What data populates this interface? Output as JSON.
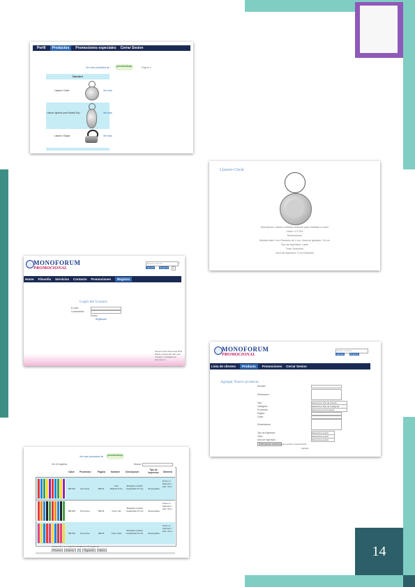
{
  "page": {
    "number": "14"
  },
  "colors": {
    "teal_light": "#7fcdc3",
    "teal_dark": "#3d8f86",
    "navy": "#2c5f67",
    "purple": "#8e59b8"
  },
  "shot1": {
    "nav": [
      "Perfil",
      "Productos",
      "Promociones especiales",
      "Cerrar Sesion"
    ],
    "header_text": "Ver mas productos de",
    "logo_text": "promoshop",
    "page_text": "Pagina 1",
    "column_header": "Nombre",
    "rows": [
      {
        "name": "Llavero Circle",
        "link": "Ver mas"
      },
      {
        "name": "Llavero Ignition para Botella Esp",
        "link": "Ver mas"
      },
      {
        "name": "Llavero Shape",
        "link": "Ver mas"
      }
    ]
  },
  "shot2": {
    "title": "Llavero Circle",
    "lines": [
      "Descripcion: Llavero metalico redondo para Grabado a Laser",
      "Clave: LLT-001",
      "Dimensiones:",
      "Medida total: 9 cm Diametro de 4 cm / Area de grabado: 2.8 cm",
      "Tipo de impresion: Laser",
      "Tinta: Seleccion",
      "Area de impresion: 2 cm Diametro"
    ]
  },
  "shot3": {
    "logo": "MONOFORUM",
    "logo_sub": "PROMOCIONAL",
    "search_placeholder": "Buscar producto",
    "login_button": "Ingresar",
    "register_button": "Registrar",
    "nav": [
      "Home",
      "Filosofia",
      "Servicios",
      "Contacto",
      "Promociones",
      "Registro"
    ],
    "form_title": "Login del Usuario",
    "email_label": "E-mail:",
    "password_label": "Contraseña:",
    "submit": "Entrar",
    "register_link": "Registrarte",
    "footer": [
      "Derecho Autor Reservado 2013",
      "Diseño y desarrollo web: web",
      "Contacto: ventas@mono",
      "foro.com.mx"
    ]
  },
  "shot4": {
    "logo": "MONOFORUM",
    "logo_sub": "PROMOCIONAL",
    "search_placeholder": "Buscar producto",
    "login_button": "Ingresar",
    "register_button": "Registrar",
    "nav": [
      "Lista de clientes",
      "Producto",
      "Promociones",
      "Cerrar Sesion"
    ],
    "form_title": "Agregar Nuevo producto",
    "fields": [
      "Nombre:",
      "Descripcion:",
      "Tipo:",
      "Categoria:",
      "Proveedor:",
      "Pagina:",
      "Clave:",
      "Dimensiones:",
      "Tipo de impresion:",
      "Tinta:",
      "Area de impresion:"
    ],
    "selects": [
      "Selecciona Tipo de Articulo",
      "Selecciona Tipo de Categoria",
      "Selecciona el Proveedor",
      "Selecciona opción",
      "Selecciona opción",
      "Selecciona opción"
    ],
    "file_button": "Seleccionar archivo",
    "file_text": "Ningún archivo seleccionado",
    "submit": "Agregar"
  },
  "shot5": {
    "header_text": "Ver mas productos de",
    "logo_text": "promoshop",
    "show_label": "Ver 10 registros",
    "search_label": "Buscar:",
    "columns": [
      "Clave",
      "Proveedor",
      "Pagina",
      "Nombre",
      "Descripcion",
      "Tipo de impresion",
      "Dimensi"
    ],
    "rows": [
      {
        "clave": "BB-010",
        "proveedor": "promoline",
        "pagina": "BB-01",
        "nombre": "Fine Ballpoint Pen",
        "descripcion": "Bolígrafo retráctil (capacidad 0.5 ml)",
        "impresion": "Tampografía",
        "dim": "Punto a / Diametro / Alto / Fino"
      },
      {
        "clave": "BB-020",
        "proveedor": "Promoline",
        "pagina": "BB-02",
        "nombre": "Color Inks",
        "descripcion": "Bolígrafo retráctil (capacidad 0.5 ml)",
        "impresion": "Tampografía",
        "dim": "Punto a / Diametro / Alto / Fino"
      },
      {
        "clave": "BB-030",
        "proveedor": "Promoline",
        "pagina": "BB-03",
        "nombre": "Color Stick",
        "descripcion": "Bolígrafo retráctil (capacidad 0.5 ml)",
        "impresion": "Tampografía",
        "dim": "Punto a / Diametro / Alto / Fino"
      }
    ],
    "footer_text": "Mostrando 1 a 3 registros (filtrado de 159 registros)",
    "pager": [
      "Primero",
      "Anterior",
      "1",
      "Siguiente",
      "Ultimo"
    ]
  }
}
